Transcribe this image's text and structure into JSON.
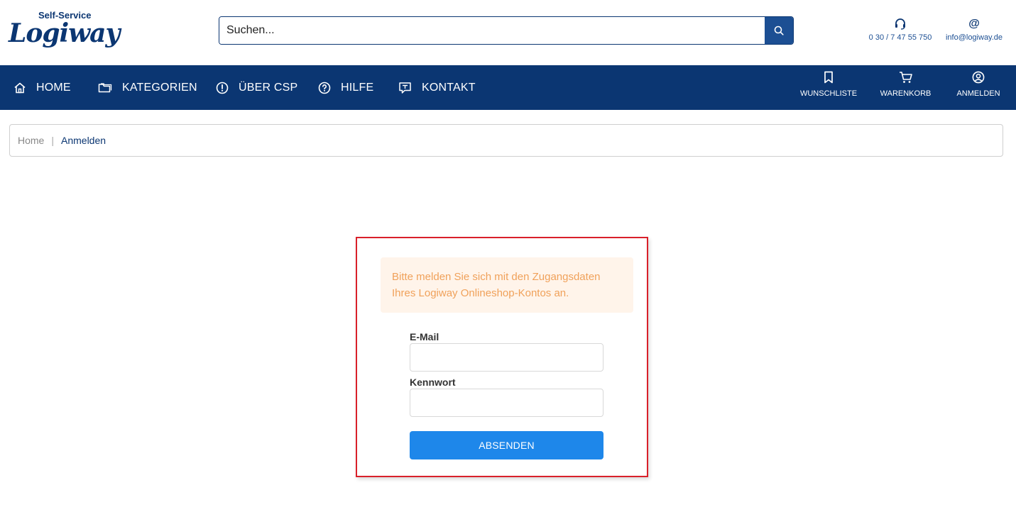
{
  "header": {
    "logo_small": "Self-Service",
    "logo_brand": "Logiway",
    "search_placeholder": "Suchen...",
    "phone": "0 30 / 7 47 55 750",
    "email": "info@logiway.de",
    "email_icon_glyph": "@"
  },
  "nav": {
    "items": [
      {
        "label": "HOME",
        "icon": "home-icon"
      },
      {
        "label": "KATEGORIEN",
        "icon": "folder-icon"
      },
      {
        "label": "ÜBER CSP",
        "icon": "info-circle-icon"
      },
      {
        "label": "HILFE",
        "icon": "question-circle-icon"
      },
      {
        "label": "KONTAKT",
        "icon": "chat-icon"
      }
    ],
    "right": [
      {
        "label": "WUNSCHLISTE",
        "icon": "bookmark-icon"
      },
      {
        "label": "WARENKORB",
        "icon": "cart-icon"
      },
      {
        "label": "ANMELDEN",
        "icon": "user-circle-icon"
      }
    ]
  },
  "breadcrumb": {
    "home": "Home",
    "separator": "|",
    "current": "Anmelden"
  },
  "login": {
    "notice": "Bitte melden Sie sich mit den Zugangsdaten Ihres Logiway Onlineshop-Kontos an.",
    "email_label": "E-Mail",
    "email_value": "",
    "password_label": "Kennwort",
    "password_value": "",
    "submit_label": "ABSENDEN"
  },
  "colors": {
    "primary": "#0b3672",
    "accent": "#1e87ea",
    "notice_bg": "#fff4ea",
    "notice_text": "#f0a15a",
    "highlight": "#d9202a"
  }
}
